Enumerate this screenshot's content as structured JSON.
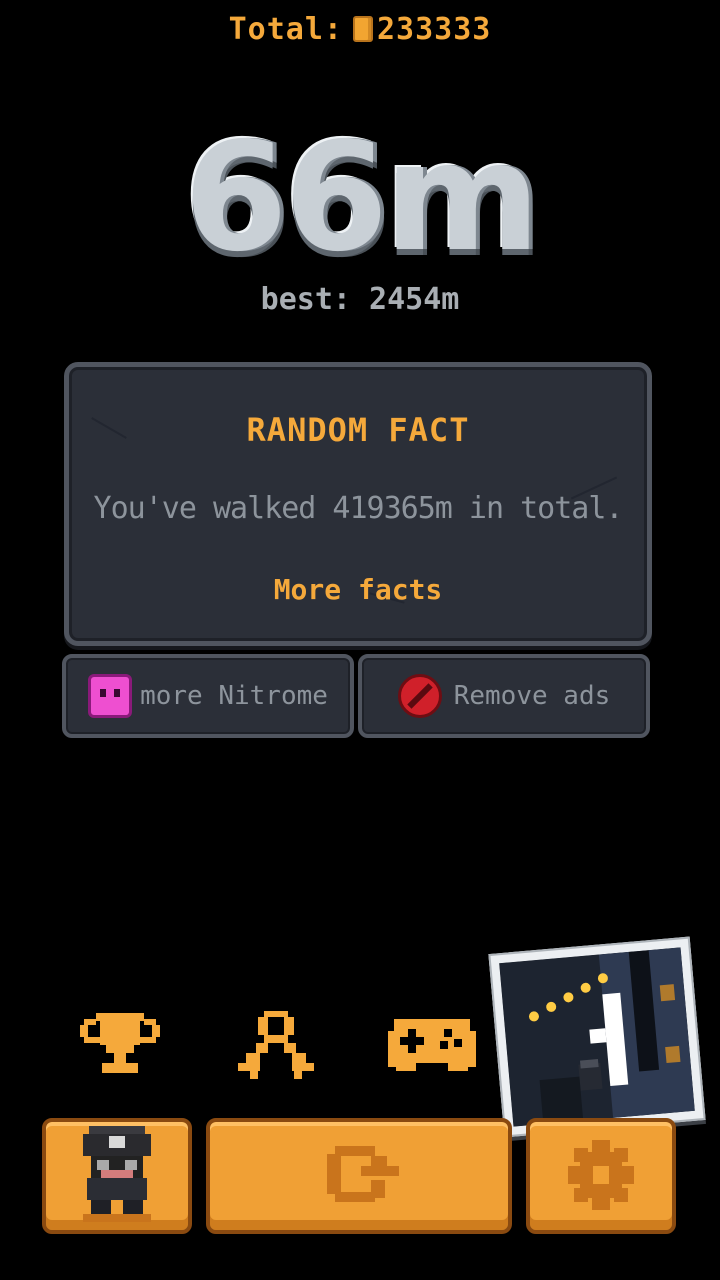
{
  "header": {
    "total_label": "Total:",
    "total_value": "233333",
    "coin_icon": "coin-icon"
  },
  "run": {
    "distance": "66m",
    "best": "best: 2454m"
  },
  "fact_panel": {
    "title": "RANDOM FACT",
    "text": "You've walked 419365m in total.",
    "more_label": "More facts"
  },
  "sub_buttons": {
    "more_nitrome": "more Nitrome",
    "remove_ads": "Remove ads"
  },
  "icons": {
    "trophy": "trophy-icon",
    "medal": "medal-icon",
    "gamepad": "gamepad-icon",
    "retry": "retry-icon",
    "settings": "gear-icon",
    "character": "character-icon"
  },
  "colors": {
    "accent": "#f5a93b",
    "panel": "#2b2f38",
    "button": "#f0a035"
  }
}
